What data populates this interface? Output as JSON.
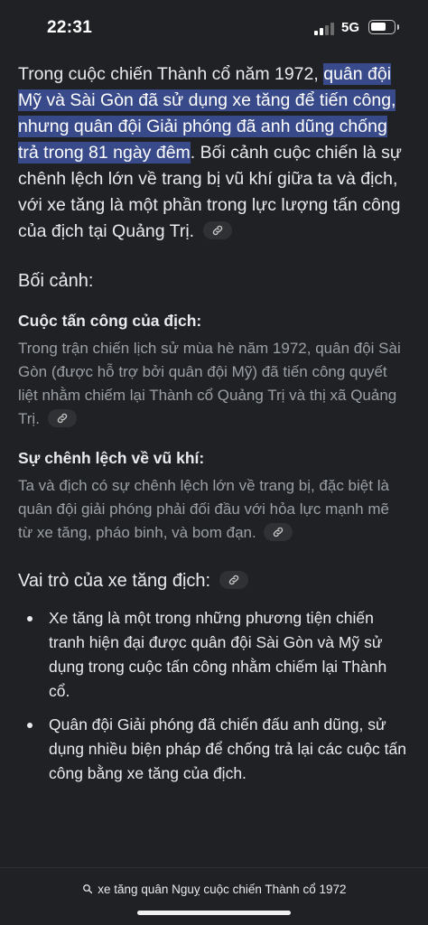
{
  "status": {
    "time": "22:31",
    "network": "5G"
  },
  "intro": {
    "before": "Trong cuộc chiến Thành cổ năm 1972, ",
    "highlight": "quân đội Mỹ và Sài Gòn đã sử dụng xe tăng để tiến công, nhưng quân đội Giải phóng đã anh dũng chống trả trong 81 ngày đêm",
    "after": ". Bối cảnh cuộc chiến là sự chênh lệch lớn về trang bị vũ khí giữa ta và địch, với xe tăng là một phần trong lực lượng tấn công của địch tại Quảng Trị."
  },
  "section_context": {
    "heading": "Bối cảnh:",
    "sub1": {
      "title": "Cuộc tấn công của địch:",
      "text": "Trong trận chiến lịch sử mùa hè năm 1972, quân đội Sài Gòn (được hỗ trợ bởi quân đội Mỹ) đã tiến công quyết liệt nhằm chiếm lại Thành cổ Quảng Trị và thị xã Quảng Trị."
    },
    "sub2": {
      "title": "Sự chênh lệch về vũ khí:",
      "text": "Ta và địch có sự chênh lệch lớn về trang bị, đặc biệt là quân đội giải phóng phải đối đầu với hỏa lực mạnh mẽ từ xe tăng, pháo binh, và bom đạn."
    }
  },
  "section_role": {
    "heading": "Vai trò của xe tăng địch:",
    "bullets": [
      "Xe tăng là một trong những phương tiện chiến tranh hiện đại được quân đội Sài Gòn và Mỹ sử dụng trong cuộc tấn công nhằm chiếm lại Thành cổ.",
      "Quân đội Giải phóng đã chiến đấu anh dũng, sử dụng nhiều biện pháp để chống trả lại các cuộc tấn công bằng xe tăng của địch."
    ]
  },
  "bottom": {
    "query": "xe tăng quân Nguỵ cuộc chiến Thành cổ 1972"
  },
  "icons": {
    "link": "link-icon",
    "search": "search-icon"
  },
  "colors": {
    "background": "#202124",
    "highlight": "#394a8a",
    "muted_text": "#9aa0a6",
    "chip": "#303134"
  }
}
